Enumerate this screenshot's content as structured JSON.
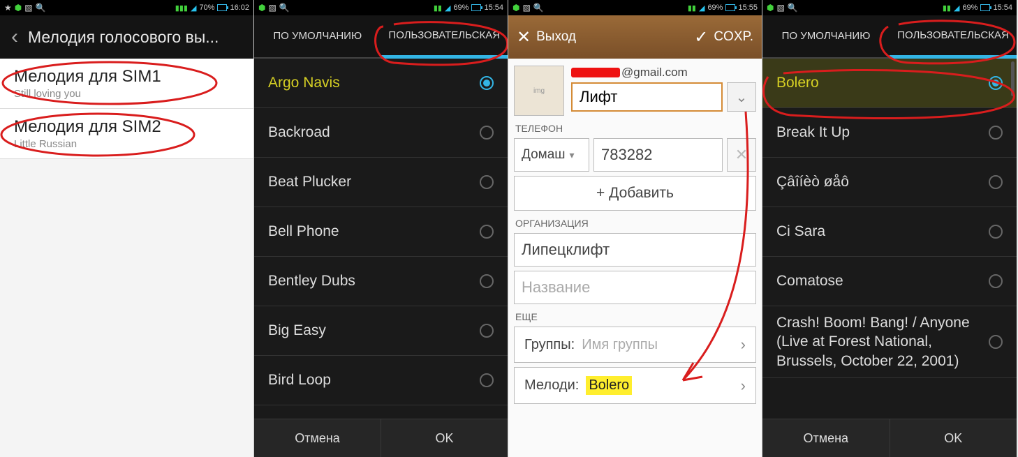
{
  "screen1": {
    "status": {
      "battery": "70%",
      "time": "16:02"
    },
    "title": "Мелодия голосового вы...",
    "items": [
      {
        "title": "Мелодия для SIM1",
        "sub": "Still loving you"
      },
      {
        "title": "Мелодия для SIM2",
        "sub": "Little Russian"
      }
    ]
  },
  "screen2": {
    "status": {
      "battery": "69%",
      "time": "15:54"
    },
    "tabs": {
      "default": "ПО УМОЛЧАНИЮ",
      "custom": "ПОЛЬЗОВАТЕЛЬСКАЯ"
    },
    "items": [
      "Argo Navis",
      "Backroad",
      "Beat Plucker",
      "Bell Phone",
      "Bentley Dubs",
      "Big Easy",
      "Bird Loop"
    ],
    "selected_index": 0,
    "footer": {
      "cancel": "Отмена",
      "ok": "OK"
    }
  },
  "screen3": {
    "status": {
      "battery": "69%",
      "time": "15:55"
    },
    "header": {
      "exit": "Выход",
      "save": "COXP."
    },
    "email_suffix": "@gmail.com",
    "name": "Лифт",
    "sections": {
      "phone": "ТЕЛЕФОН",
      "org": "ОРГАНИЗАЦИЯ",
      "more": "ЕЩЕ"
    },
    "phone_type": "Домаш",
    "phone_value": "783282",
    "add_label": "+  Добавить",
    "org_value": "Липецклифт",
    "org_placeholder": "Название",
    "groups_label": "Группы:",
    "groups_placeholder": "Имя группы",
    "ringtone_label": "Мелоди:",
    "ringtone_value": "Bolero"
  },
  "screen4": {
    "status": {
      "battery": "69%",
      "time": "15:54"
    },
    "tabs": {
      "default": "ПО УМОЛЧАНИЮ",
      "custom": "ПОЛЬЗОВАТЕЛЬСКАЯ"
    },
    "items": [
      "Bolero",
      "Break It Up",
      "Çâîíèò øåô",
      "Ci Sara",
      "Comatose",
      "Crash! Boom! Bang! / Anyone (Live at Forest National, Brussels, October 22, 2001)"
    ],
    "selected_index": 0,
    "footer": {
      "cancel": "Отмена",
      "ok": "OK"
    }
  }
}
